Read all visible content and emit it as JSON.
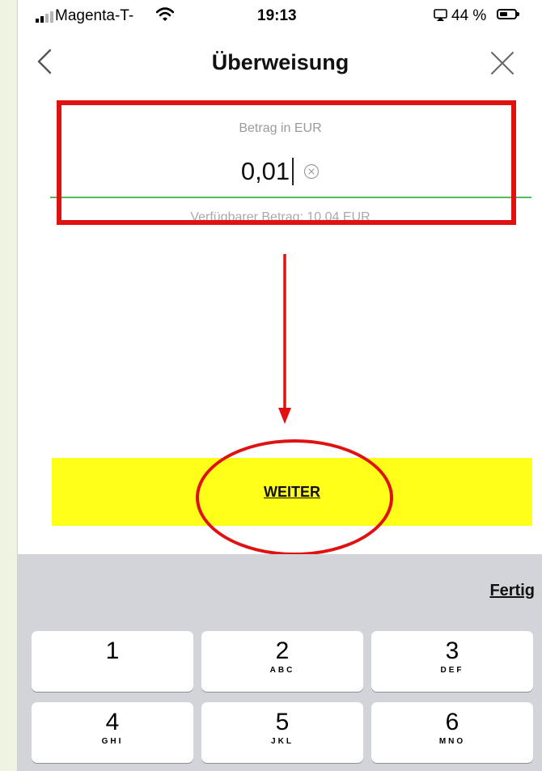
{
  "status_bar": {
    "carrier": "Magenta-T-",
    "time": "19:13",
    "battery_percent": "44 %",
    "battery_level": 0.44
  },
  "nav": {
    "title": "Überweisung"
  },
  "amount": {
    "label": "Betrag in EUR",
    "value": "0,01",
    "available_text": "Verfügbarer Betrag: 10,04 EUR"
  },
  "primary_button": {
    "label": "WEITER",
    "color": "#ffff1a"
  },
  "annotation": {
    "color": "#e01111"
  },
  "keyboard": {
    "done_label": "Fertig",
    "keys": [
      {
        "digit": "1",
        "letters": ""
      },
      {
        "digit": "2",
        "letters": "ABC"
      },
      {
        "digit": "3",
        "letters": "DEF"
      },
      {
        "digit": "4",
        "letters": "GHI"
      },
      {
        "digit": "5",
        "letters": "JKL"
      },
      {
        "digit": "6",
        "letters": "MNO"
      }
    ]
  }
}
